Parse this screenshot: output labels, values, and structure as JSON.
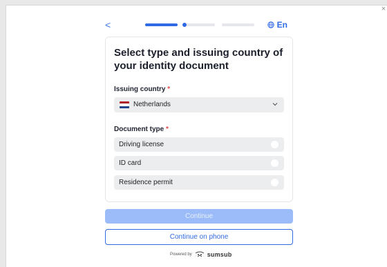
{
  "window": {
    "close_label": "×"
  },
  "header": {
    "back_label": "<",
    "language": "En",
    "progress": {
      "steps": 3,
      "current_step": 2
    }
  },
  "card": {
    "title": "Select type and issuing country of your identity document",
    "issuing_country": {
      "label": "Issuing country",
      "required_mark": "*",
      "selected": "Netherlands"
    },
    "document_type": {
      "label": "Document type",
      "required_mark": "*",
      "options": [
        {
          "label": "Driving license"
        },
        {
          "label": "ID card"
        },
        {
          "label": "Residence permit"
        }
      ]
    }
  },
  "actions": {
    "continue_label": "Continue",
    "continue_phone_label": "Continue on phone"
  },
  "footer": {
    "powered_by": "Powered by",
    "brand": "sumsub"
  },
  "colors": {
    "accent": "#2f6ae4",
    "disabled_button": "#9bbcf8",
    "required": "#e64646",
    "flag_red": "#ae1c28",
    "flag_white": "#ffffff",
    "flag_blue": "#21468b"
  }
}
